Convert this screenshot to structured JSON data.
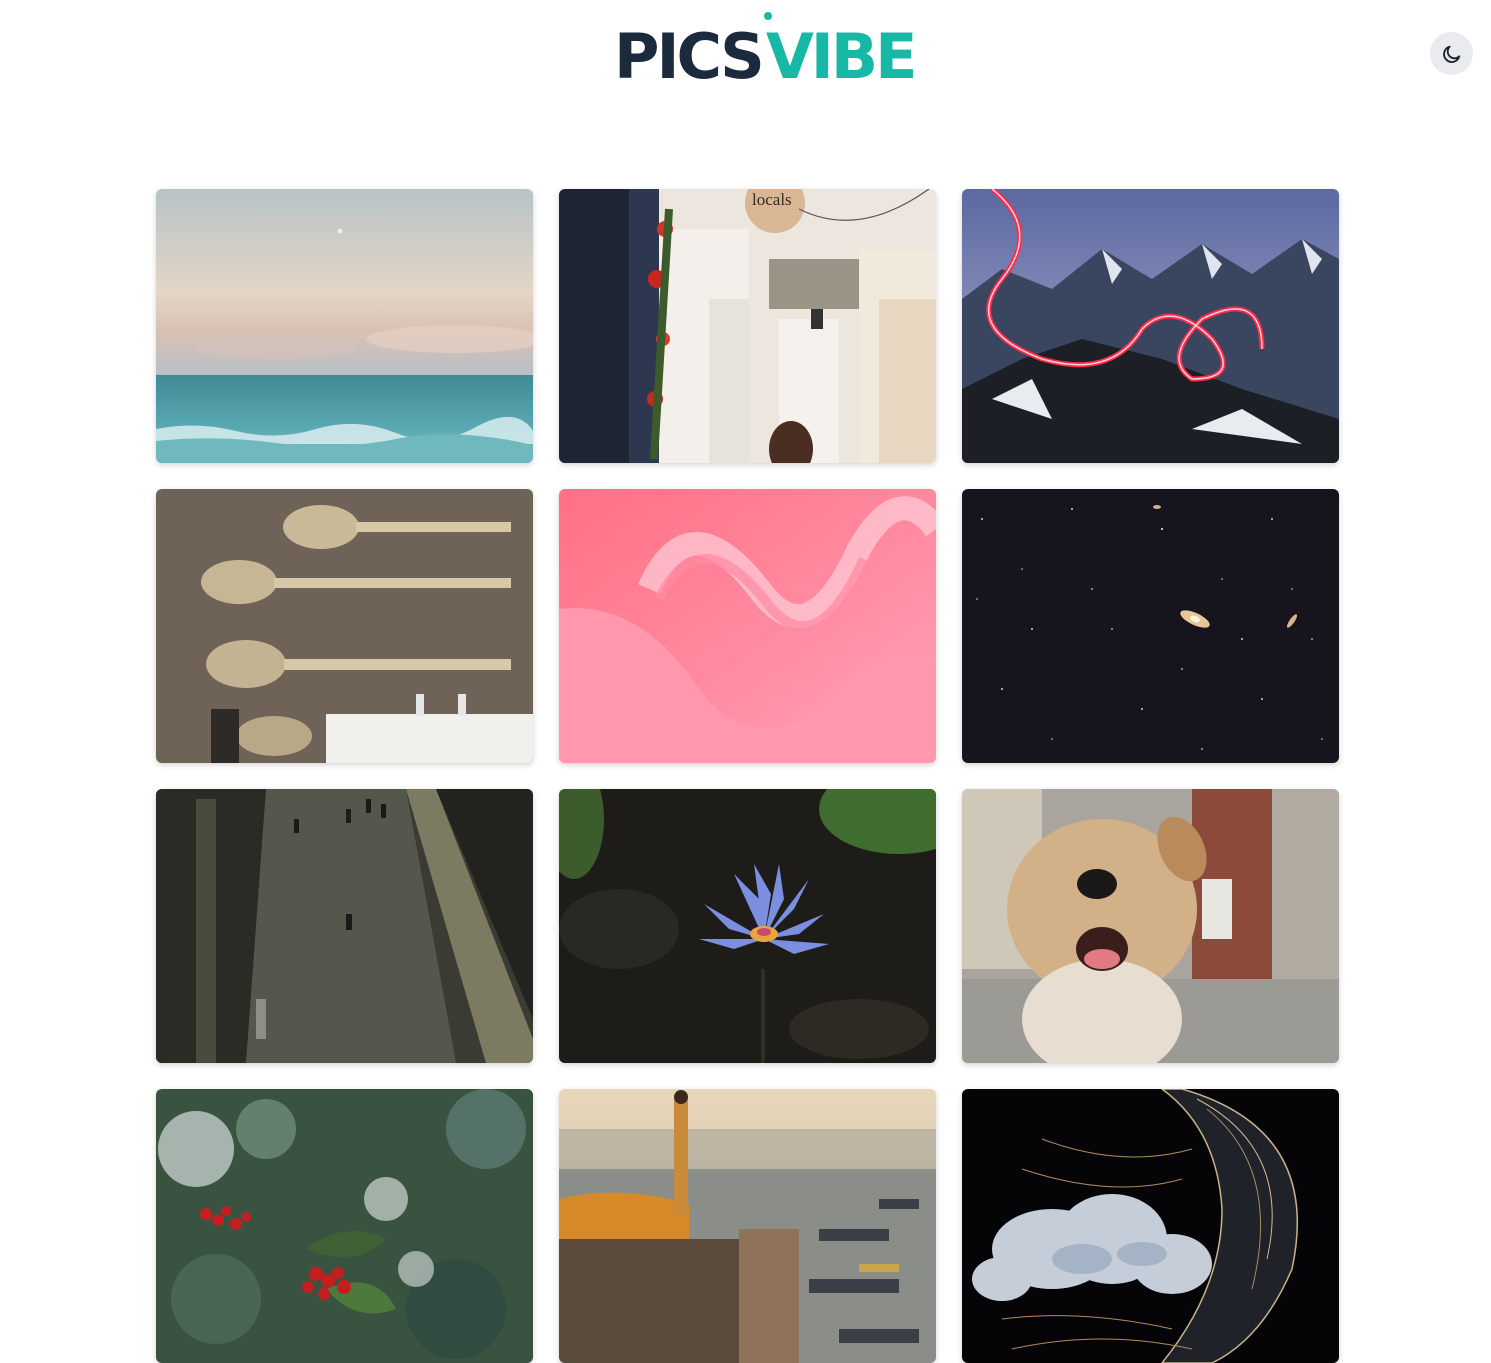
{
  "brand": {
    "part1": "PICS",
    "part2": "VIBE",
    "colors": {
      "dark": "#1b2a3d",
      "accent": "#17b8a6"
    }
  },
  "theme_toggle": {
    "icon": "moon-icon"
  },
  "gallery": {
    "photos": [
      {
        "subject": "ocean-horizon-photo"
      },
      {
        "subject": "whitewashed-alley-photo"
      },
      {
        "subject": "light-painting-mountains-photo"
      },
      {
        "subject": "giant-spoons-wall-photo"
      },
      {
        "subject": "pink-ribbon-abstract-photo"
      },
      {
        "subject": "starfield-galaxies-photo"
      },
      {
        "subject": "walkway-travelers-photo"
      },
      {
        "subject": "blue-water-lily-photo"
      },
      {
        "subject": "fluffy-dog-photo"
      },
      {
        "subject": "holly-berries-photo"
      },
      {
        "subject": "river-ghats-boats-photo"
      },
      {
        "subject": "jellyfish-photo"
      }
    ]
  }
}
